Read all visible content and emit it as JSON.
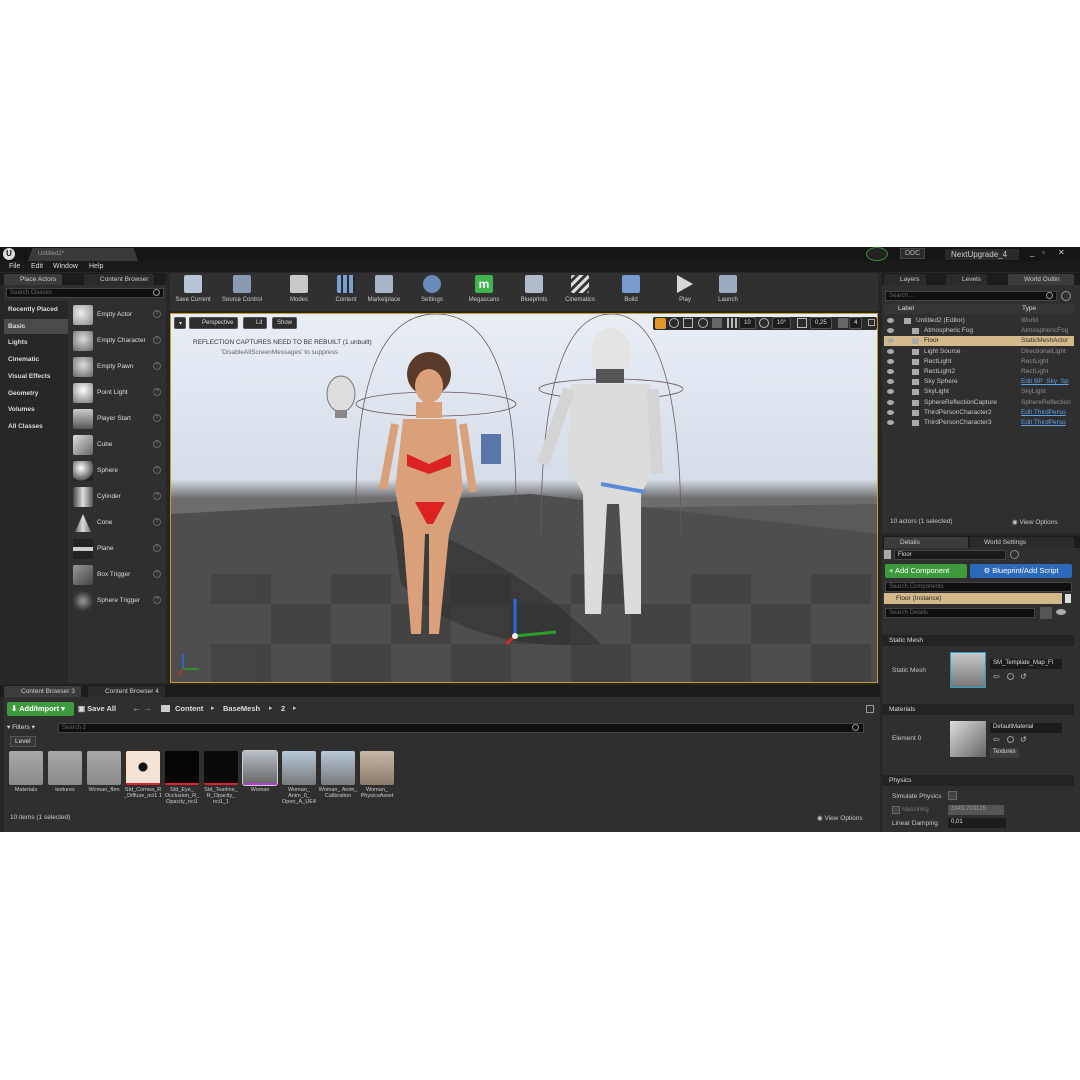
{
  "window": {
    "doc_tab": "Untitled2*",
    "ddc": "DDC",
    "project": "NextUpgrade_4"
  },
  "menu": [
    "File",
    "Edit",
    "Window",
    "Help"
  ],
  "left_panel": {
    "tabs": [
      "Place Actors",
      "Content Browser"
    ],
    "search_placeholder": "Search Classes",
    "categories": [
      "Recently Placed",
      "Basic",
      "Lights",
      "Cinematic",
      "Visual Effects",
      "Geometry",
      "Volumes",
      "All Classes"
    ],
    "items": [
      "Empty Actor",
      "Empty Character",
      "Empty Pawn",
      "Point Light",
      "Player Start",
      "Cube",
      "Sphere",
      "Cylinder",
      "Cone",
      "Plane",
      "Box Trigger",
      "Sphere Trigger"
    ]
  },
  "toolbar": [
    "Save Current",
    "Source Control",
    "Modes",
    "Content",
    "Marketplace",
    "Settings",
    "Megascans",
    "Blueprints",
    "Cinematics",
    "Build",
    "Play",
    "Launch"
  ],
  "viewport": {
    "perspective": "Perspective",
    "lit": "Lit",
    "show": "Show",
    "warning_line1": "REFLECTION CAPTURES NEED TO BE REBUILT (1 unbuilt)",
    "warning_line2": "'DisableAllScreenMessages' to suppress",
    "grid_snap": "10",
    "rot_snap": "10°",
    "scale_snap": "0,25",
    "cam_speed": "4"
  },
  "outliner": {
    "tabs": [
      "Layers",
      "Levels",
      "World Outlin"
    ],
    "search_placeholder": "Search...",
    "col_label": "Label",
    "col_type": "Type",
    "rows": [
      {
        "label": "Untitled2 (Editor)",
        "type": "World",
        "link": false
      },
      {
        "label": "Atmospheric Fog",
        "type": "AtmosphericFog",
        "link": false
      },
      {
        "label": "Floor",
        "type": "StaticMeshActor",
        "link": false
      },
      {
        "label": "Light Source",
        "type": "DirectionalLight",
        "link": false
      },
      {
        "label": "RectLight",
        "type": "RectLight",
        "link": false
      },
      {
        "label": "RectLight2",
        "type": "RectLight",
        "link": false
      },
      {
        "label": "Sky Sphere",
        "type": "Edit BP_Sky_Sp",
        "link": true
      },
      {
        "label": "SkyLight",
        "type": "SkyLight",
        "link": false
      },
      {
        "label": "SphereReflectionCapture",
        "type": "SphereReflection",
        "link": false
      },
      {
        "label": "ThirdPersonCharacter2",
        "type": "Edit ThirdPerso",
        "link": true
      },
      {
        "label": "ThirdPersonCharacter3",
        "type": "Edit ThirdPerso",
        "link": true
      }
    ],
    "status": "10 actors (1 selected)",
    "view_options": "View Options"
  },
  "details": {
    "tabs": [
      "Details",
      "World Settings"
    ],
    "name": "Floor",
    "add_component": "+ Add Component",
    "blueprint": "Blueprint/Add Script",
    "search_components": "Search Components",
    "instance": "Floor (Instance)",
    "search_details": "Search Details",
    "static_mesh_section": "Static Mesh",
    "static_mesh_label": "Static Mesh",
    "static_mesh_value": "SM_Template_Map_Fl",
    "materials_section": "Materials",
    "element_label": "Element 0",
    "element_value": "DefaultMaterial",
    "textures": "Textures",
    "physics_section": "Physics",
    "simulate": "Simulate Physics",
    "mass_label": "MassInKg",
    "mass_value": "3343,703125",
    "damping_label": "Linear Damping",
    "damping_value": "0,01"
  },
  "content_browser": {
    "tabs": [
      "Content Browser 3",
      "Content Browser 4"
    ],
    "add_import": "Add/Import",
    "save_all": "Save All",
    "path": [
      "Content",
      "BaseMesh",
      "2"
    ],
    "filters": "Filters",
    "search_placeholder": "Search 2",
    "level_chip": "Level",
    "items": [
      "Materials",
      "textures",
      "Woman_fbm",
      "Std_Cornea_R _Diffuse_nci1 1",
      "Std_Eye_ Occlusion_R_ Opacity_nci1",
      "Std_Tearline_ R_Opacity_ nci1_1",
      "Woman",
      "Woman_ Anim_0_ Open_A_UE4",
      "Woman_ Anim_ Calibration",
      "Woman_ PhysicsAsset"
    ],
    "status": "10 items (1 selected)",
    "view_options": "View Options"
  }
}
